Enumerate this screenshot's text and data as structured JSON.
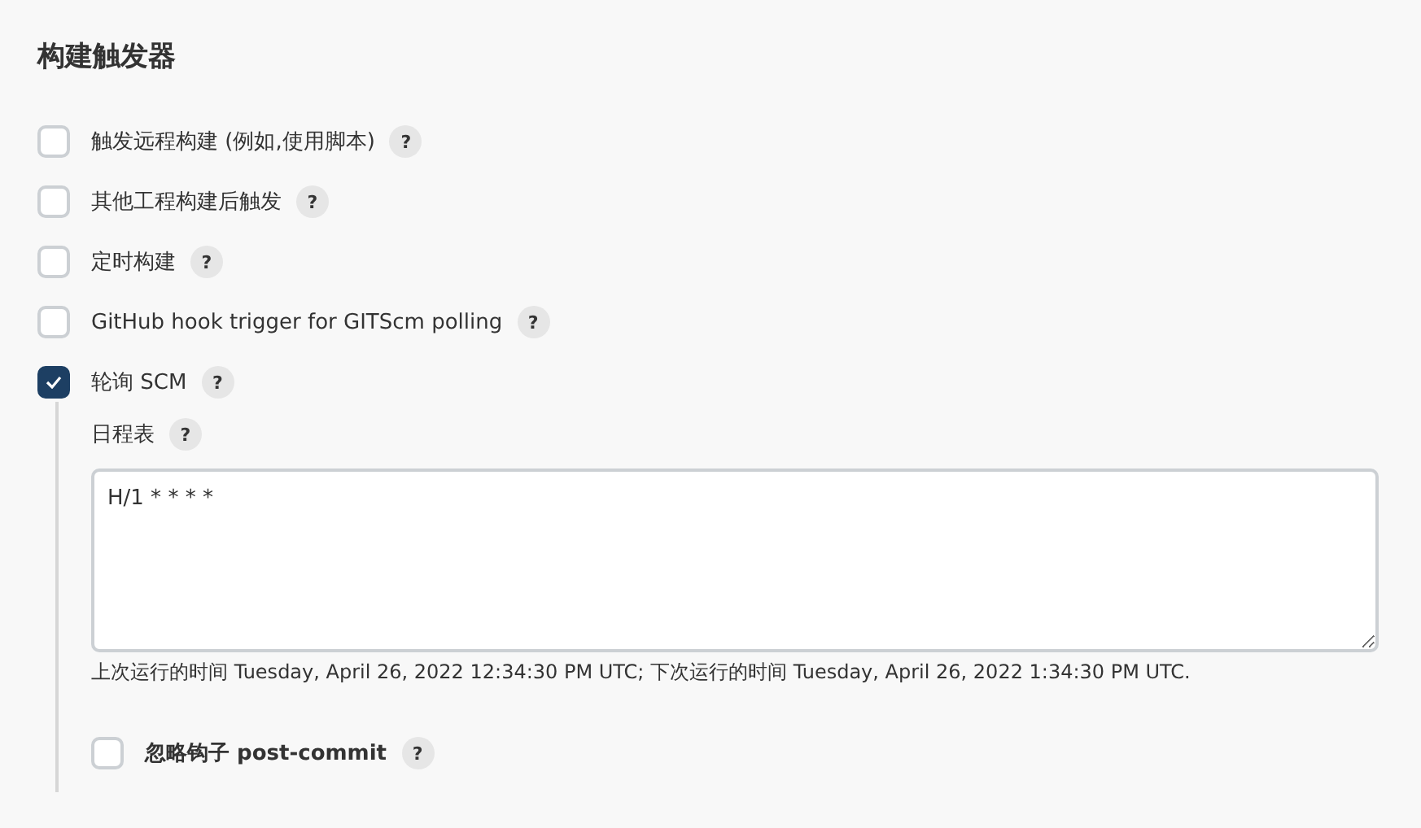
{
  "section_title": "构建触发器",
  "triggers": [
    {
      "label": "触发远程构建 (例如,使用脚本)",
      "checked": false,
      "help": "?"
    },
    {
      "label": "其他工程构建后触发",
      "checked": false,
      "help": "?"
    },
    {
      "label": "定时构建",
      "checked": false,
      "help": "?"
    },
    {
      "label": "GitHub hook trigger for GITScm polling",
      "checked": false,
      "help": "?"
    },
    {
      "label": "轮询 SCM",
      "checked": true,
      "help": "?",
      "details": {
        "schedule_label": "日程表",
        "schedule_help": "?",
        "schedule_value": "H/1 * * * *",
        "schedule_hint": "上次运行的时间 Tuesday, April 26, 2022 12:34:30 PM UTC; 下次运行的时间 Tuesday, April 26, 2022 1:34:30 PM UTC.",
        "options": [
          {
            "label": "忽略钩子 post-commit",
            "checked": false,
            "help": "?"
          }
        ]
      }
    }
  ]
}
